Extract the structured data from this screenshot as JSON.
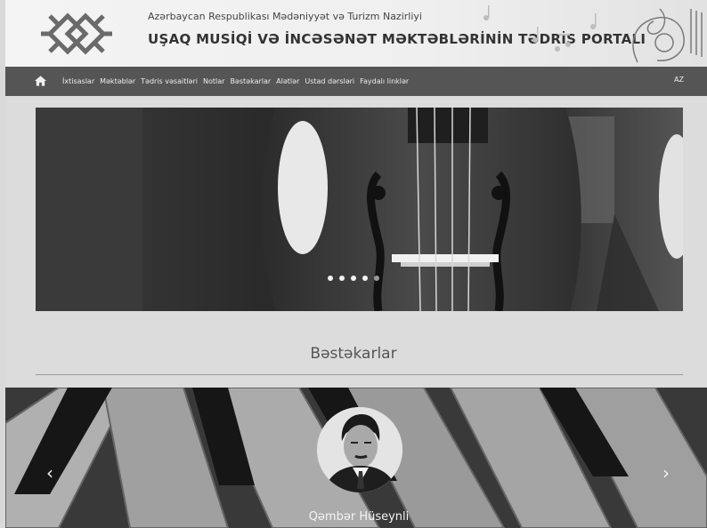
{
  "header": {
    "ministry": "Azərbaycan Respublikası Mədəniyyət və Turizm Nazirliyi",
    "portal_title": "UŞAQ MUSİQİ VƏ İNCƏSƏNƏT MƏKTƏBLƏRİNİN TƏDRİS PORTALI",
    "logo_icon": "ornament-logo-icon"
  },
  "nav": {
    "home_icon": "home-icon",
    "items": [
      "İxtisaslar",
      "Məktəblər",
      "Tədris vəsaitləri",
      "Notlar",
      "Bəstəkarlar",
      "Alətlər",
      "Ustad dərsləri",
      "Faydalı linklər"
    ],
    "language": "AZ"
  },
  "slider": {
    "dots_count": 5,
    "active_dot": 1
  },
  "section": {
    "title": "Bəstəkarlar"
  },
  "composer": {
    "name": "Qəmbər Hüseynli",
    "prev_label": "‹",
    "next_label": "›"
  }
}
